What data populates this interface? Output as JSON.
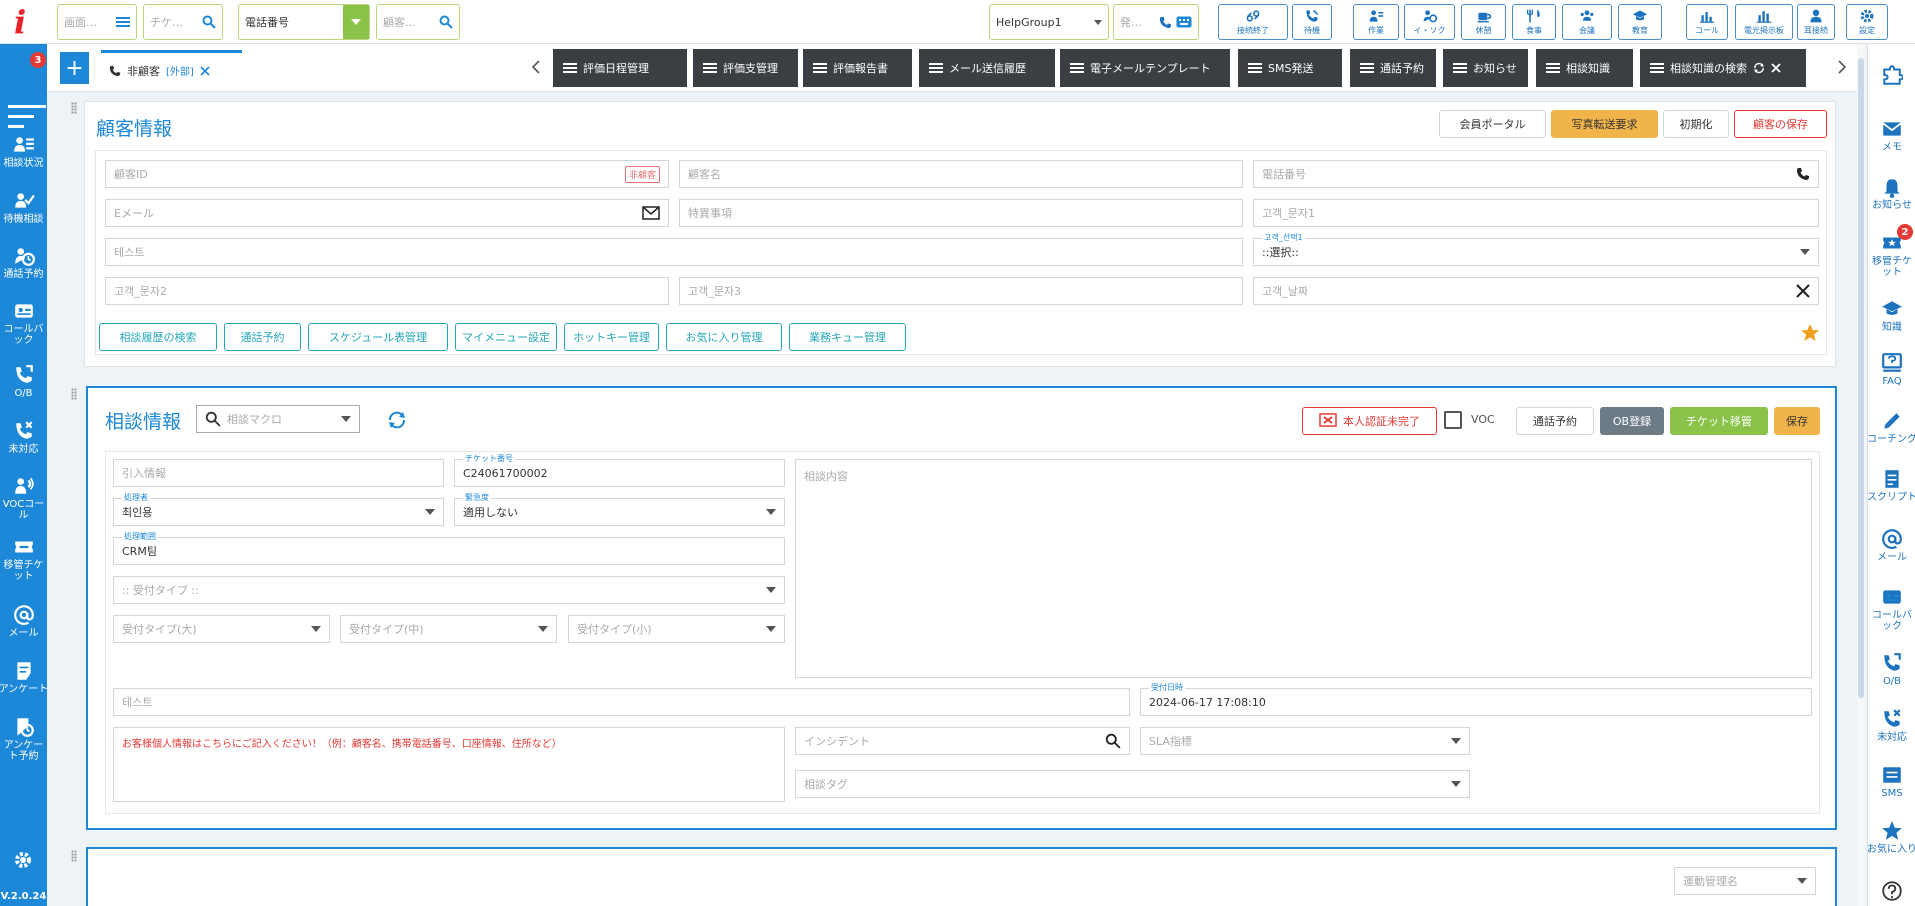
{
  "app": {
    "logo": "i",
    "version": "V.2.0.24"
  },
  "topbar": {
    "screen_search_placeholder": "画面…",
    "ticket_search_placeholder": "チケ…",
    "phone_select_value": "電話番号",
    "customer_search_placeholder": "顧客…",
    "group_select_value": "HelpGroup1",
    "outbound_placeholder": "発…",
    "buttons": [
      {
        "label": "接続終了",
        "icon": "unlink-icon"
      },
      {
        "label": "待機",
        "icon": "standby-icon"
      },
      {
        "label": "作業",
        "icon": "work-icon"
      },
      {
        "label": "イ・ソク",
        "icon": "timer-icon"
      },
      {
        "label": "休憩",
        "icon": "coffee-icon"
      },
      {
        "label": "食事",
        "icon": "meal-icon"
      },
      {
        "label": "会議",
        "icon": "meeting-icon"
      },
      {
        "label": "教育",
        "icon": "education-icon"
      },
      {
        "label": "コール",
        "icon": "call-chart-icon"
      },
      {
        "label": "電光掲示板",
        "icon": "board-chart-icon"
      },
      {
        "label": "耳接続",
        "icon": "listen-icon"
      },
      {
        "label": "設定",
        "icon": "settings-icon"
      }
    ]
  },
  "leftbar": {
    "top_badge": "3",
    "items": [
      {
        "label": "相談状況",
        "icon": "consult-status-icon"
      },
      {
        "label": "待機相談",
        "icon": "waiting-consult-icon"
      },
      {
        "label": "通話予約",
        "icon": "call-reserve-icon"
      },
      {
        "label": "コールバック",
        "icon": "callback-icon"
      },
      {
        "label": "O/B",
        "icon": "outbound-icon"
      },
      {
        "label": "未対応",
        "icon": "missed-call-icon"
      },
      {
        "label": "VOCコール",
        "icon": "voc-call-icon"
      },
      {
        "label": "移管チケット",
        "icon": "transfer-ticket-icon"
      },
      {
        "label": "メール",
        "icon": "mail-at-icon"
      },
      {
        "label": "アンケート",
        "icon": "survey-icon"
      },
      {
        "label": "アンケート予約",
        "icon": "survey-reserve-icon"
      }
    ]
  },
  "rightbar": {
    "items": [
      {
        "label": "",
        "icon": "puzzle-icon"
      },
      {
        "label": "メモ",
        "icon": "memo-icon"
      },
      {
        "label": "お知らせ",
        "icon": "bell-icon"
      },
      {
        "label": "移管チケット",
        "icon": "ticket-star-icon",
        "badge": "2"
      },
      {
        "label": "知識",
        "icon": "knowledge-icon"
      },
      {
        "label": "FAQ",
        "icon": "faq-icon"
      },
      {
        "label": "コーチング",
        "icon": "pen-icon"
      },
      {
        "label": "スクリプト",
        "icon": "script-icon"
      },
      {
        "label": "メール",
        "icon": "mail-at-icon"
      },
      {
        "label": "コールバック",
        "icon": "callback-icon"
      },
      {
        "label": "O/B",
        "icon": "outbound-icon"
      },
      {
        "label": "未対応",
        "icon": "missed-call-icon"
      },
      {
        "label": "SMS",
        "icon": "sms-icon"
      },
      {
        "label": "お気に入り",
        "icon": "star-icon"
      },
      {
        "label": "",
        "icon": "help-icon"
      }
    ]
  },
  "tabs": {
    "customer_tab": {
      "label": "非顧客",
      "tag": "[外部]"
    },
    "dark_tabs": [
      "評価日程管理",
      "評価支管理",
      "評価報告書",
      "メール送信履歴",
      "電子メールテンプレート",
      "SMS発送",
      "通話予約",
      "お知らせ",
      "相談知識",
      "相談知識の検索"
    ]
  },
  "customer": {
    "title": "顧客情報",
    "buttons": {
      "portal": "会員ポータル",
      "photo": "写真転送要求",
      "reset": "初期化",
      "save": "顧客の保存"
    },
    "fields": {
      "id_placeholder": "顧客ID",
      "id_tag": "非顧客",
      "name_placeholder": "顧客名",
      "phone_placeholder": "電話番号",
      "email_placeholder": "Eメール",
      "special_placeholder": "特異事項",
      "text1_placeholder": "고객_문자1",
      "test_placeholder": "테스트",
      "select1_label": "고객_선택1",
      "select1_value": "::選択::",
      "text2_placeholder": "고객_문자2",
      "text3_placeholder": "고객_문자3",
      "date_placeholder": "고객_날짜"
    },
    "action_buttons": [
      "相談履歴の検索",
      "通話予約",
      "スケジュール表管理",
      "マイメニュー設定",
      "ホットキー管理",
      "お気に入り管理",
      "業務キュー管理"
    ]
  },
  "consult": {
    "title": "相談情報",
    "macro_placeholder": "相談マクロ",
    "auth_badge": "本人認証未完了",
    "voc_label": "VOC",
    "buttons": {
      "reserve": "通話予約",
      "ob": "OB登録",
      "ticket": "チケット移管",
      "save": "保存"
    },
    "fields": {
      "handover_placeholder": "引入情報",
      "ticket_label": "チケット番号",
      "ticket_value": "C24061700002",
      "handler_label": "処理者",
      "handler_value": "최인용",
      "urgency_label": "緊急度",
      "urgency_value": "適用しない",
      "dept_label": "処理範囲",
      "dept_value": "CRM팀",
      "type_placeholder": ":: 受付タイプ ::",
      "type_large": "受付タイプ(大)",
      "type_mid": "受付タイプ(中)",
      "type_small": "受付タイプ(小)",
      "content_placeholder": "相談内容",
      "test_placeholder": "테스트",
      "received_label": "受付日時",
      "received_value": "2024-06-17 17:08:10",
      "privacy_note": "お客様個人情報はこちらにご記入ください！（例：顧客名、携帯電話番号、口座情報、住所など）",
      "incident_placeholder": "インシデント",
      "sla_placeholder": "SLA指標",
      "tag_placeholder": "相談タグ"
    }
  },
  "third_panel": {
    "select_placeholder": "運動管理名"
  },
  "colors": {
    "primary": "#1e88d8",
    "green": "#8bc34a",
    "orange": "#f0b44a",
    "teal": "#26a7b8",
    "danger": "#e53935"
  }
}
